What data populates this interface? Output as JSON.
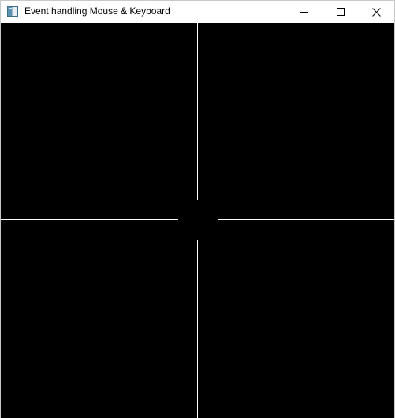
{
  "window": {
    "title": "Event handling Mouse & Keyboard",
    "app_icon": "app-window-icon",
    "controls": {
      "minimize_icon": "minimize-icon",
      "maximize_icon": "maximize-icon",
      "close_icon": "close-icon"
    }
  },
  "canvas": {
    "background_color": "#000000",
    "line_color": "#ffffff",
    "center_circle_color": "#000000"
  }
}
